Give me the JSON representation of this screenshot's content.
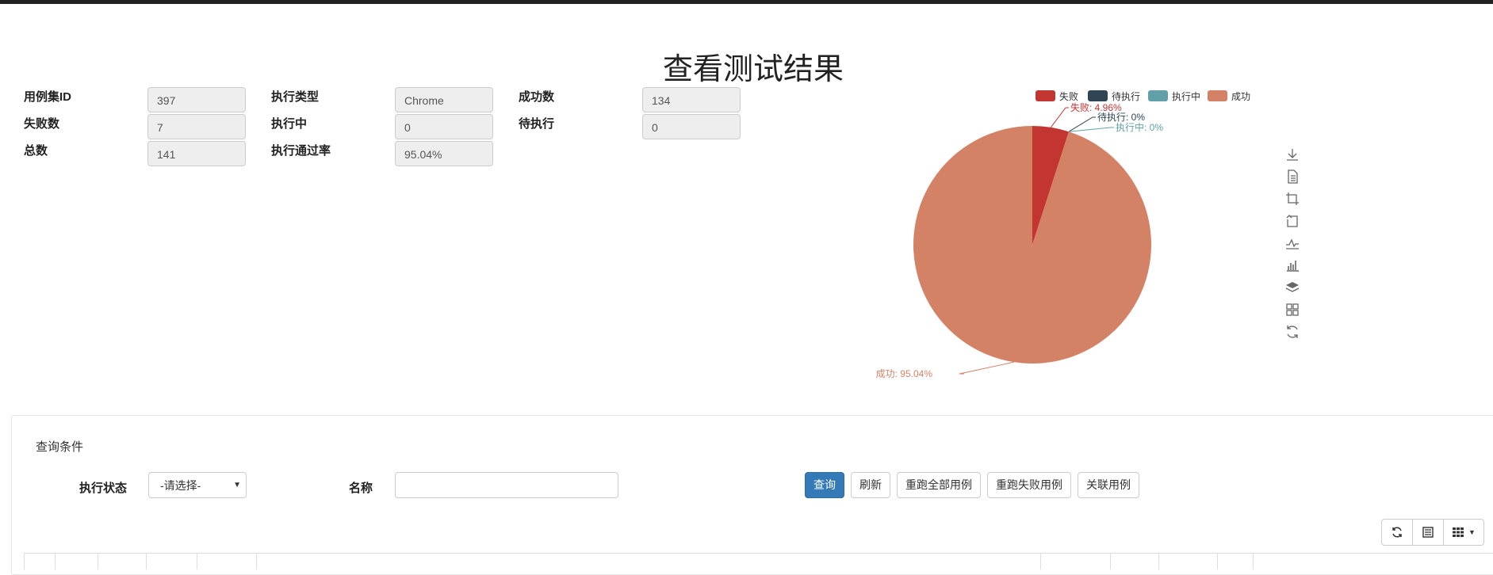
{
  "page": {
    "title": "查看测试结果"
  },
  "summary": {
    "suite_id": {
      "label": "用例集ID",
      "value": "397"
    },
    "exec_type": {
      "label": "执行类型",
      "value": "Chrome"
    },
    "success": {
      "label": "成功数",
      "value": "134"
    },
    "failed": {
      "label": "失败数",
      "value": "7"
    },
    "running": {
      "label": "执行中",
      "value": "0"
    },
    "pending": {
      "label": "待执行",
      "value": "0"
    },
    "total": {
      "label": "总数",
      "value": "141"
    },
    "pass_rate": {
      "label": "执行通过率",
      "value": "95.04%"
    }
  },
  "chart_data": {
    "type": "pie",
    "legend": [
      "失败",
      "待执行",
      "执行中",
      "成功"
    ],
    "legend_position": "top",
    "slices": [
      {
        "name": "失败",
        "value": 7,
        "percent": "4.96%",
        "color": "#c23531",
        "label": "失败: 4.96%"
      },
      {
        "name": "待执行",
        "value": 0,
        "percent": "0%",
        "color": "#2f4554",
        "label": "待执行: 0%"
      },
      {
        "name": "执行中",
        "value": 0,
        "percent": "0%",
        "color": "#61a0a8",
        "label": "执行中: 0%"
      },
      {
        "name": "成功",
        "value": 134,
        "percent": "95.04%",
        "color": "#d48265",
        "label": "成功: 95.04%"
      }
    ]
  },
  "toolbox": [
    "download-icon",
    "data-view-icon",
    "zoom-icon",
    "zoom-reset-icon",
    "line-chart-icon",
    "bar-chart-icon",
    "stack-icon",
    "tiled-icon",
    "restore-icon"
  ],
  "query": {
    "title": "查询条件",
    "status_label": "执行状态",
    "status_selected": "-请选择-",
    "name_label": "名称",
    "name_value": "",
    "buttons": {
      "search": "查询",
      "refresh": "刷新",
      "rerun_all": "重跑全部用例",
      "rerun_failed": "重跑失败用例",
      "link_cases": "关联用例"
    }
  },
  "table_toolbar": [
    "refresh-icon",
    "list-icon",
    "columns-icon"
  ],
  "colors": {
    "primary": "#337ab7",
    "fail": "#c23531",
    "pending": "#2f4554",
    "running": "#61a0a8",
    "success": "#d48265"
  }
}
